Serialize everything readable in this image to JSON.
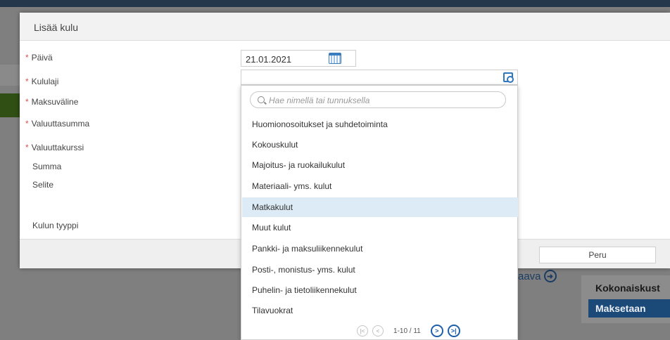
{
  "dialog": {
    "title": "Lisää kulu",
    "cancel_label": "Peru"
  },
  "fields": {
    "paiva": {
      "label": "Päivä",
      "value": "21.01.2021"
    },
    "kululaji": {
      "label": "Kululaji"
    },
    "maksuvaline": {
      "label": "Maksuväline"
    },
    "valuuttasumma": {
      "label": "Valuuttasumma"
    },
    "valuuttakurssi": {
      "label": "Valuuttakurssi"
    },
    "summa": {
      "label": "Summa"
    },
    "selite": {
      "label": "Selite"
    },
    "kulun_tyyppi": {
      "label": "Kulun tyyppi"
    }
  },
  "dropdown": {
    "search_placeholder": "Hae nimellä tai tunnuksella",
    "options": [
      "Huomionosoitukset ja suhdetoiminta",
      "Kokouskulut",
      "Majoitus- ja ruokailukulut",
      "Materiaali- yms. kulut",
      "Matkakulut",
      "Muut kulut",
      "Pankki- ja maksuliikennekulut",
      "Posti-, monistus- yms. kulut",
      "Puhelin- ja tietoliikennekulut",
      "Tilavuokrat"
    ],
    "selected_option": "Matkakulut",
    "pager": {
      "count": "1-10 / 11"
    }
  },
  "background": {
    "next_label": "aava",
    "total_label": "Kokonaiskust",
    "status_badge": "Maksetaan"
  },
  "colors": {
    "required_star": "#d9534f",
    "selected_row": "#dcebf6",
    "primary_blue": "#1d5fa8",
    "badge_bg": "#1c4a78"
  },
  "icons": {
    "date": "calendar-icon",
    "lookup": "lookup-icon",
    "search": "search-icon",
    "pager": [
      "first-page-icon",
      "prev-page-icon",
      "next-page-icon",
      "last-page-icon"
    ]
  }
}
